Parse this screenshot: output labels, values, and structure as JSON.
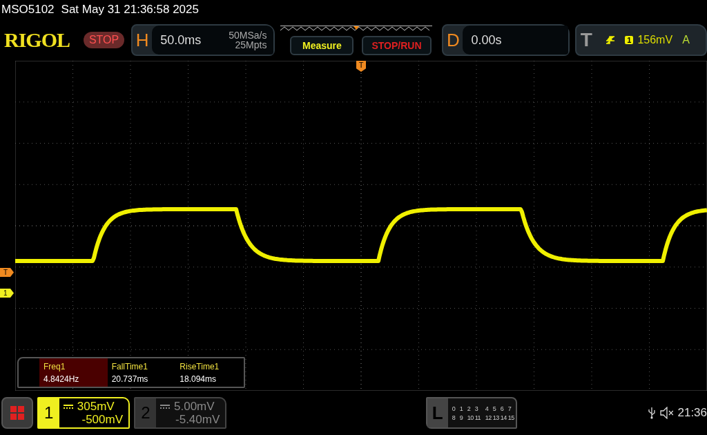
{
  "status_line": {
    "model": "MSO5102",
    "datetime": "Sat May 31 21:36:58 2025"
  },
  "header": {
    "logo": "RIGOL",
    "run_state": "STOP",
    "horizontal": {
      "label": "H",
      "timebase": "50.0ms",
      "sample_rate": "50MSa/s",
      "memory_depth": "25Mpts"
    },
    "buttons": [
      {
        "label": "Measure",
        "kind": "menu"
      },
      {
        "label": "STOP/RUN",
        "kind": "run"
      }
    ],
    "delay": {
      "label": "D",
      "value": "0.00s"
    },
    "trigger": {
      "label": "T",
      "source": "1",
      "level": "156mV",
      "mode": "A"
    }
  },
  "markers": {
    "trigger_position_label": "T",
    "trigger_level_label": "T",
    "channel_label": "1"
  },
  "measurements": [
    {
      "name": "Freq1",
      "value": "4.8424Hz",
      "selected": true
    },
    {
      "name": "FallTime1",
      "value": "20.737ms",
      "selected": false
    },
    {
      "name": "RiseTime1",
      "value": "18.094ms",
      "selected": false
    }
  ],
  "channels": [
    {
      "number": "1",
      "scale": "305mV",
      "offset": "-500mV",
      "selected": true
    },
    {
      "number": "2",
      "scale": "5.00mV",
      "offset": "-5.40mV",
      "selected": false
    }
  ],
  "logic": {
    "label": "L",
    "rows": [
      [
        "0",
        "1",
        "2",
        "3",
        "4",
        "5",
        "6",
        "7"
      ],
      [
        "8",
        "9",
        "10",
        "11",
        "12",
        "13",
        "14",
        "15"
      ]
    ]
  },
  "status_bar": {
    "time": "21:36"
  }
}
